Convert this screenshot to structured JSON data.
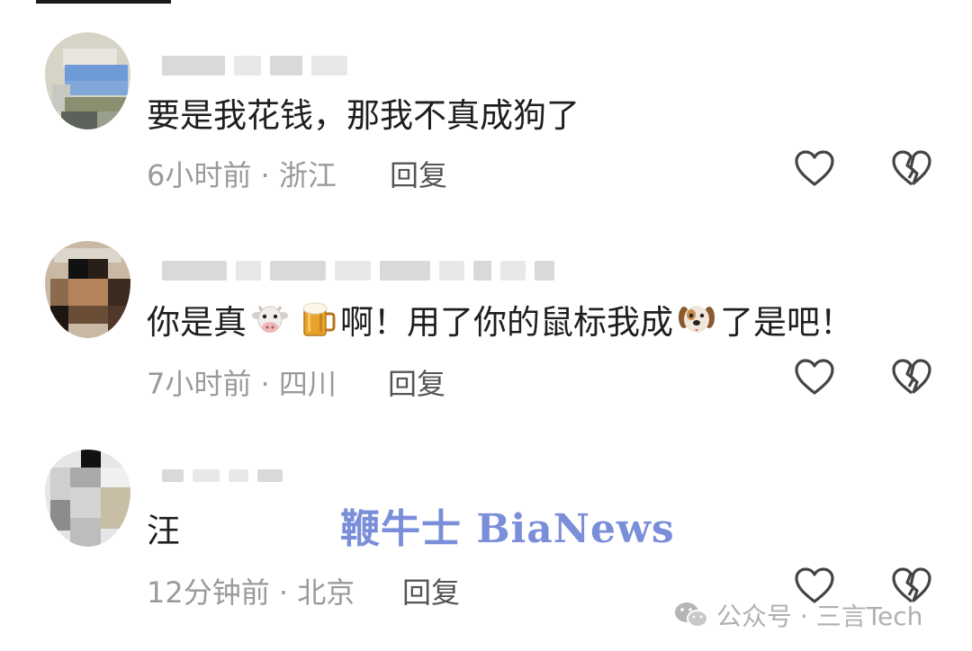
{
  "comments": [
    {
      "text_a": "要是我花钱，那我不真成狗了",
      "time_location": "6小时前 · 浙江",
      "reply_label": "回复",
      "avatar_icon": "pixelated-avatar"
    },
    {
      "text_a": "你是真",
      "emoji_1": "cow-emoji",
      "emoji_2": "beer-mug-emoji",
      "text_b": "啊！用了你的鼠标我成",
      "emoji_3": "dog-face-emoji",
      "text_c": "了是吧！",
      "time_location": "7小时前 · 四川",
      "reply_label": "回复",
      "avatar_icon": "pixelated-avatar"
    },
    {
      "text_a": "汪",
      "time_location": "12分钟前 · 北京",
      "reply_label": "回复",
      "avatar_icon": "pixelated-avatar"
    }
  ],
  "icons": {
    "like": "heart-outline-icon",
    "dislike": "broken-heart-outline-icon"
  },
  "watermark": "鞭牛士 BiaNews",
  "source_label": "公众号 · 三言Tech",
  "colors": {
    "text": "#1e1e1e",
    "meta": "#9a9a9a",
    "watermark": "#6f85d6"
  }
}
